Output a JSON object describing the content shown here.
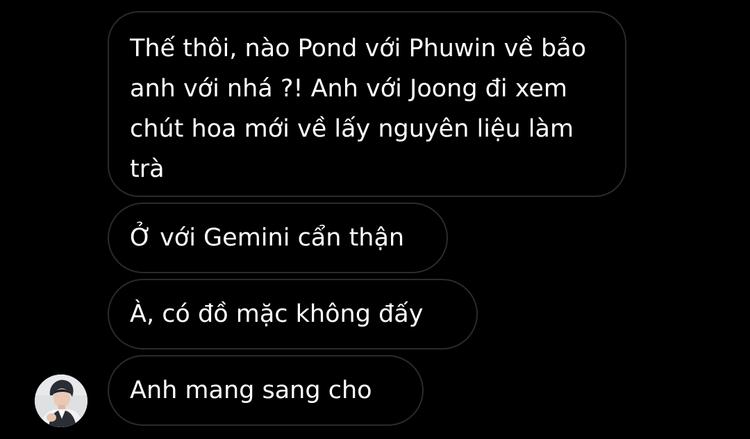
{
  "conversation": {
    "messages": [
      {
        "text": "Thế thôi, nào Pond với Phuwin về bảo anh với nhá ?! Anh với Joong đi xem chút hoa mới về lấy nguyên liệu làm trà"
      },
      {
        "text": "Ở với Gemini cẩn thận"
      },
      {
        "text": "À, có đồ mặc không đấy"
      },
      {
        "text": "Anh mang sang cho"
      }
    ]
  },
  "colors": {
    "background": "#000000",
    "bubble_border": "#2b2b2b",
    "text": "#ffffff"
  },
  "icons": {
    "avatar": "user-avatar-photo"
  }
}
